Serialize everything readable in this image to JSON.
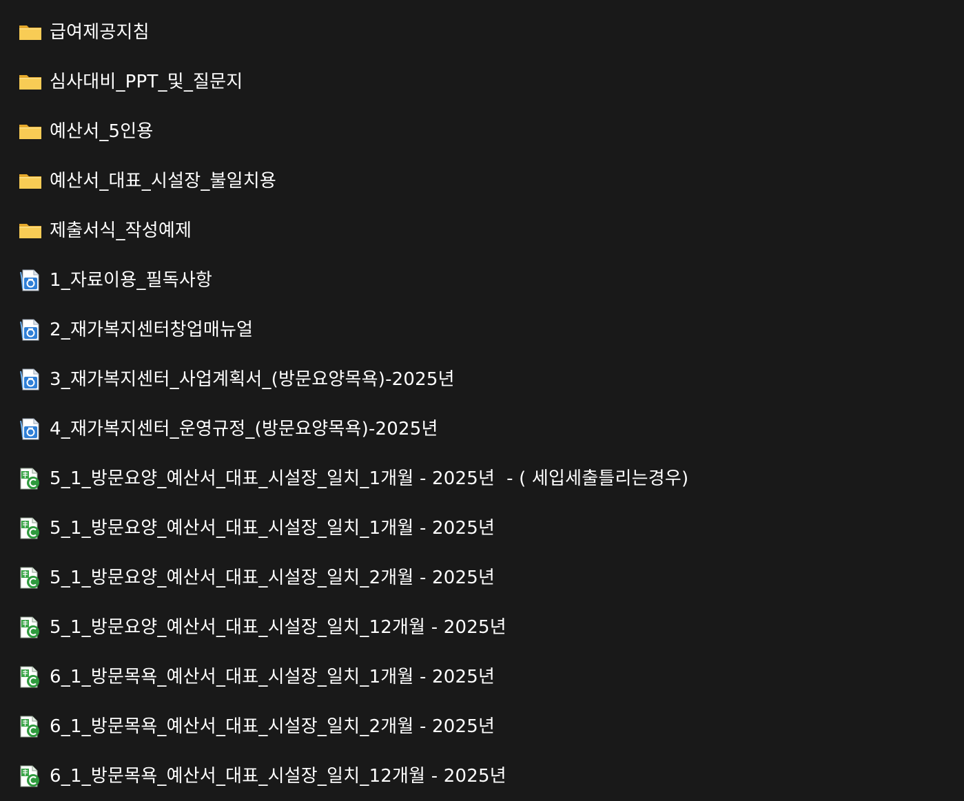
{
  "items": [
    {
      "label": "급여제공지침",
      "type": "folder",
      "icon": "folder-icon"
    },
    {
      "label": "심사대비_PPT_및_질문지",
      "type": "folder",
      "icon": "folder-icon"
    },
    {
      "label": "예산서_5인용",
      "type": "folder",
      "icon": "folder-icon"
    },
    {
      "label": "예산서_대표_시설장_불일치용",
      "type": "folder",
      "icon": "folder-icon"
    },
    {
      "label": "제출서식_작성예제",
      "type": "folder",
      "icon": "folder-icon"
    },
    {
      "label": "1_자료이용_필독사항",
      "type": "hwp",
      "icon": "hwp-document-icon"
    },
    {
      "label": "2_재가복지센터창업매뉴얼",
      "type": "hwp",
      "icon": "hwp-document-icon"
    },
    {
      "label": "3_재가복지센터_사업계획서_(방문요양목욕)-2025년",
      "type": "hwp",
      "icon": "hwp-document-icon"
    },
    {
      "label": "4_재가복지센터_운영규정_(방문요양목욕)-2025년",
      "type": "hwp",
      "icon": "hwp-document-icon"
    },
    {
      "label": "5_1_방문요양_예산서_대표_시설장_일치_1개월 - 2025년  - ( 세입세출틀리는경우)",
      "type": "cell",
      "icon": "spreadsheet-icon"
    },
    {
      "label": "5_1_방문요양_예산서_대표_시설장_일치_1개월 - 2025년",
      "type": "cell",
      "icon": "spreadsheet-icon"
    },
    {
      "label": "5_1_방문요양_예산서_대표_시설장_일치_2개월 - 2025년",
      "type": "cell",
      "icon": "spreadsheet-icon"
    },
    {
      "label": "5_1_방문요양_예산서_대표_시설장_일치_12개월 - 2025년",
      "type": "cell",
      "icon": "spreadsheet-icon"
    },
    {
      "label": "6_1_방문목욕_예산서_대표_시설장_일치_1개월 - 2025년",
      "type": "cell",
      "icon": "spreadsheet-icon"
    },
    {
      "label": "6_1_방문목욕_예산서_대표_시설장_일치_2개월 - 2025년",
      "type": "cell",
      "icon": "spreadsheet-icon"
    },
    {
      "label": "6_1_방문목욕_예산서_대표_시설장_일치_12개월 - 2025년",
      "type": "cell",
      "icon": "spreadsheet-icon"
    }
  ],
  "colors": {
    "background": "#191919",
    "text": "#ffffff",
    "folder": "#f7c64b",
    "hwp_accent": "#2f7fd6",
    "cell_accent": "#3aa548"
  }
}
